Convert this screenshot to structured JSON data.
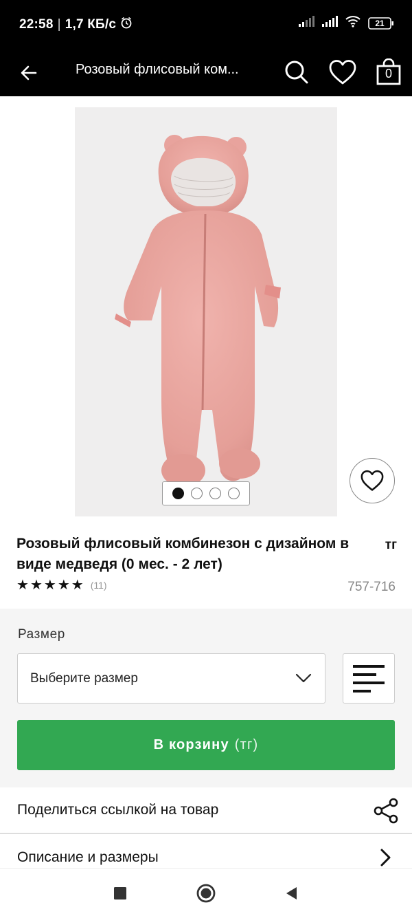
{
  "status_bar": {
    "time": "22:58",
    "network_speed": "1,7 КБ/с",
    "battery": "21",
    "icons": [
      "alarm-icon",
      "signal-icon",
      "signal-icon",
      "wifi-icon",
      "battery-icon"
    ]
  },
  "app_bar": {
    "title": "Розовый флисовый ком...",
    "bag_count": "0",
    "icons": [
      "back-arrow-icon",
      "search-icon",
      "heart-icon",
      "shopping-bag-icon"
    ]
  },
  "gallery": {
    "image_count": 4,
    "active_index": 0
  },
  "product": {
    "title": "Розовый флисовый комбинезон с дизайном в виде медведя (0 мес. - 2 лет)",
    "currency": "тг",
    "rating_stars": 5,
    "review_count": "(11)",
    "sku": "757-716"
  },
  "size": {
    "label": "Размер",
    "placeholder": "Выберите размер"
  },
  "cart": {
    "label": "В корзину",
    "currency": "(тг)",
    "color": "#32a852"
  },
  "rows": {
    "share_label": "Поделиться ссылкой на товар",
    "description_label": "Описание и размеры"
  }
}
